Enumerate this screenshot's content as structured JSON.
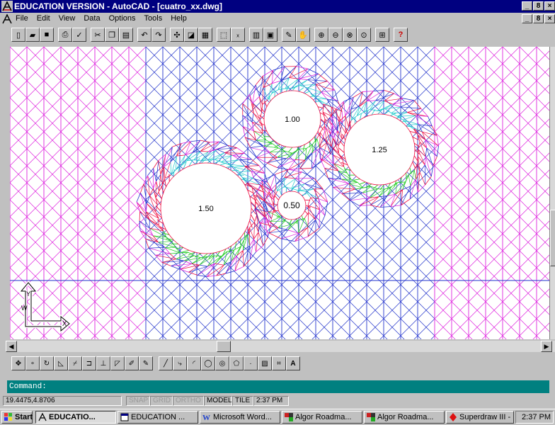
{
  "window": {
    "title": "EDUCATION VERSION - AutoCAD - [cuatro_xx.dwg]",
    "controls": [
      "_",
      "8",
      "×"
    ]
  },
  "menu": {
    "items": [
      {
        "label": "File"
      },
      {
        "label": "Edit"
      },
      {
        "label": "View"
      },
      {
        "label": "Data"
      },
      {
        "label": "Options"
      },
      {
        "label": "Tools"
      },
      {
        "label": "Help"
      }
    ]
  },
  "drawing": {
    "circles": [
      {
        "label": "1.00"
      },
      {
        "label": "1.25"
      },
      {
        "label": "1.50"
      },
      {
        "label": "0.50"
      }
    ],
    "ucs_labels": {
      "y": "Y",
      "x": "X",
      "w": "W"
    }
  },
  "command": {
    "prompt": "Command:"
  },
  "status": {
    "coords": "19.4475,4.8706",
    "snap": "SNAP",
    "grid": "GRID",
    "ortho": "ORTHO",
    "model": "MODEL",
    "tile": "TILE",
    "time": "2:37 PM"
  },
  "taskbar": {
    "start": "Start",
    "tasks": [
      {
        "label": "EDUCATIO...",
        "active": true
      },
      {
        "label": "EDUCATION ..."
      },
      {
        "label": "Microsoft Word..."
      },
      {
        "label": "Algor Roadma..."
      },
      {
        "label": "Algor Roadma..."
      },
      {
        "label": "Superdraw III - ..."
      }
    ],
    "clock": "2:37 PM"
  },
  "colors": {
    "titlebar": "#000080",
    "command_bar": "#008080",
    "mesh_blue": "#2233cc",
    "mesh_magenta": "#dd22dd",
    "mesh_red": "#ee1144",
    "mesh_green": "#22cc22",
    "mesh_cyan": "#22cccc"
  }
}
